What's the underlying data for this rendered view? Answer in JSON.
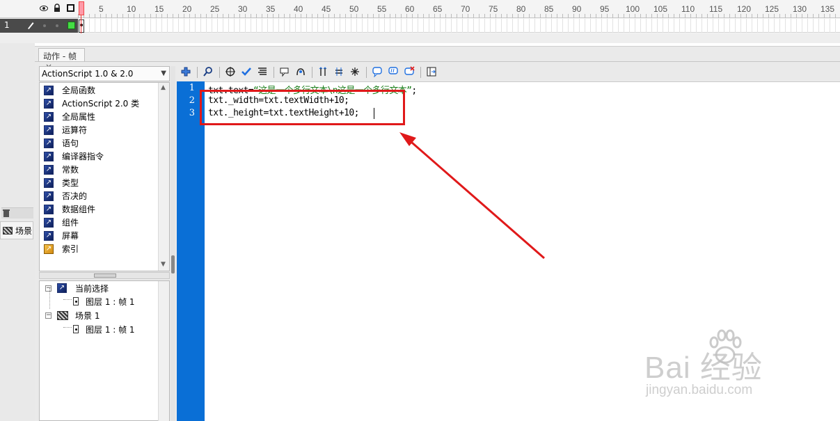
{
  "timeline": {
    "header_icons": [
      "eye-icon",
      "lock-icon",
      "outline-square-icon"
    ],
    "ruler_ticks": [
      "5",
      "10",
      "15",
      "20",
      "25",
      "30",
      "35",
      "40",
      "45",
      "50",
      "55",
      "60",
      "65",
      "70",
      "75",
      "80",
      "85",
      "90",
      "95",
      "100",
      "105",
      "110",
      "115",
      "120",
      "125",
      "130",
      "135"
    ],
    "layer": {
      "number": "1"
    }
  },
  "sidebar": {
    "scene_label": "场景"
  },
  "panel": {
    "tab_label": "动作 - 帧",
    "tab_close": "×",
    "version_select": "ActionScript 1.0 & 2.0",
    "toolbox": [
      {
        "label": "全局函数",
        "icon": "book-icon"
      },
      {
        "label": "ActionScript 2.0 类",
        "icon": "book-icon"
      },
      {
        "label": "全局属性",
        "icon": "book-icon"
      },
      {
        "label": "运算符",
        "icon": "book-icon"
      },
      {
        "label": "语句",
        "icon": "book-icon"
      },
      {
        "label": "编译器指令",
        "icon": "book-icon"
      },
      {
        "label": "常数",
        "icon": "book-icon"
      },
      {
        "label": "类型",
        "icon": "book-icon"
      },
      {
        "label": "否决的",
        "icon": "book-icon"
      },
      {
        "label": "数据组件",
        "icon": "book-icon"
      },
      {
        "label": "组件",
        "icon": "book-icon"
      },
      {
        "label": "屏幕",
        "icon": "book-icon"
      },
      {
        "label": "索引",
        "icon": "index-book-icon"
      }
    ],
    "script_navigator": {
      "current_selection": "当前选择",
      "current_frame": "图层 1 : 帧 1",
      "scene": "场景 1",
      "scene_frame": "图层 1 : 帧 1"
    }
  },
  "toolbar": {
    "icons": [
      "add-item-icon",
      "find-icon",
      "target-icon",
      "check-syntax-icon",
      "auto-format-icon",
      "code-hint-icon",
      "debug-options-icon",
      "collapse-braces-icon",
      "collapse-selection-icon",
      "expand-all-icon",
      "apply-block-comment-icon",
      "apply-line-comment-icon",
      "remove-comment-icon",
      "show-toolbox-icon"
    ]
  },
  "editor": {
    "line_numbers": [
      "1",
      "2",
      "3"
    ],
    "lines": [
      {
        "prefix": "txt.text=",
        "string": "“这是一个多行文本\\n这是一个多行文本”",
        "suffix": ";"
      },
      {
        "prefix": "txt._width=txt.textWidth+10;",
        "string": "",
        "suffix": ""
      },
      {
        "prefix": "txt._height=txt.textHeight+10;",
        "string": "",
        "suffix": ""
      }
    ]
  },
  "watermark": {
    "brand": "Bai 经验",
    "url": "jingyan.baidu.com"
  },
  "colors": {
    "gutter": "#0a6fd6",
    "string_literal": "#1a7f1a",
    "annotation_red": "#e0191a"
  }
}
